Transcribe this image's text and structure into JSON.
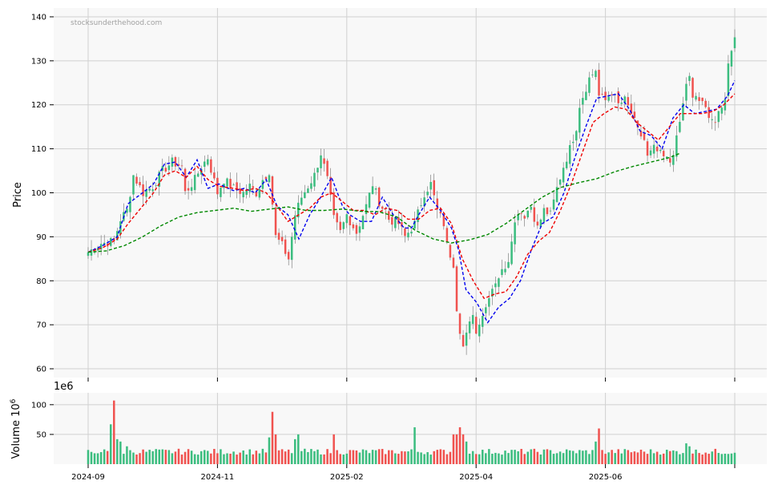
{
  "watermark": "stocksunderthehood.com",
  "colors": {
    "up": "#3bbd7f",
    "down": "#f0524f",
    "ma_fast": "#0000ee",
    "ma_mid": "#ee0000",
    "ma_slow": "#008800",
    "panel_bg": "#f8f8f8",
    "grid": "#d0d0d0"
  },
  "chart_data": [
    {
      "type": "candlestick",
      "ylabel": "Price",
      "ylim": [
        58,
        142
      ],
      "yticks": [
        60,
        70,
        80,
        90,
        100,
        110,
        120,
        130,
        140
      ],
      "grid": true,
      "x_date_labels": [
        "2024-09",
        "2024-11",
        "2025-02",
        "2025-04",
        "2025-06"
      ],
      "x_date_positions": [
        0,
        40,
        80,
        120,
        160
      ],
      "n_bars": 201,
      "close_anchors": [
        [
          0,
          86.5
        ],
        [
          4,
          88.5
        ],
        [
          8,
          89
        ],
        [
          10,
          94
        ],
        [
          12,
          96
        ],
        [
          14,
          104
        ],
        [
          17,
          100
        ],
        [
          20,
          101.5
        ],
        [
          23,
          105
        ],
        [
          26,
          107
        ],
        [
          29,
          106
        ],
        [
          30,
          100
        ],
        [
          33,
          103
        ],
        [
          35,
          106
        ],
        [
          37,
          108
        ],
        [
          40,
          100
        ],
        [
          42,
          103
        ],
        [
          45,
          101
        ],
        [
          48,
          100
        ],
        [
          50,
          101.5
        ],
        [
          52,
          100
        ],
        [
          54,
          103
        ],
        [
          56,
          105
        ],
        [
          58,
          90
        ],
        [
          60,
          88
        ],
        [
          62,
          85
        ],
        [
          64,
          95
        ],
        [
          66,
          99
        ],
        [
          68,
          101.5
        ],
        [
          70,
          104
        ],
        [
          72,
          109
        ],
        [
          74,
          103
        ],
        [
          76,
          94
        ],
        [
          78,
          91
        ],
        [
          80,
          95
        ],
        [
          83,
          91
        ],
        [
          86,
          97
        ],
        [
          88,
          102
        ],
        [
          90,
          98
        ],
        [
          93,
          94
        ],
        [
          96,
          93
        ],
        [
          98,
          90
        ],
        [
          101,
          93
        ],
        [
          104,
          100
        ],
        [
          106,
          102
        ],
        [
          108,
          96
        ],
        [
          110,
          93
        ],
        [
          111,
          88
        ],
        [
          113,
          84
        ],
        [
          114,
          74
        ],
        [
          115,
          69
        ],
        [
          116,
          65
        ],
        [
          118,
          70
        ],
        [
          119,
          73
        ],
        [
          120,
          68
        ],
        [
          121,
          71
        ],
        [
          123,
          74
        ],
        [
          124,
          77
        ],
        [
          126,
          80
        ],
        [
          128,
          82
        ],
        [
          130,
          85
        ],
        [
          131,
          90
        ],
        [
          133,
          96
        ],
        [
          135,
          95
        ],
        [
          137,
          97
        ],
        [
          139,
          92
        ],
        [
          141,
          96
        ],
        [
          143,
          95
        ],
        [
          145,
          101
        ],
        [
          147,
          106
        ],
        [
          149,
          110
        ],
        [
          151,
          115
        ],
        [
          152,
          120
        ],
        [
          155,
          126
        ],
        [
          157,
          128
        ],
        [
          158,
          122
        ],
        [
          160,
          121
        ],
        [
          162,
          123
        ],
        [
          164,
          120
        ],
        [
          166,
          121
        ],
        [
          168,
          118
        ],
        [
          170,
          114
        ],
        [
          172,
          112
        ],
        [
          173,
          108
        ],
        [
          175,
          110
        ],
        [
          178,
          108
        ],
        [
          180,
          107
        ],
        [
          182,
          112
        ],
        [
          184,
          120
        ],
        [
          185,
          125
        ],
        [
          186,
          126
        ],
        [
          187,
          121
        ],
        [
          188,
          122
        ],
        [
          190,
          120
        ],
        [
          192,
          118
        ],
        [
          194,
          116
        ],
        [
          196,
          119
        ],
        [
          197,
          122
        ],
        [
          198,
          129
        ],
        [
          199,
          133
        ],
        [
          200,
          136
        ]
      ],
      "series": [
        {
          "name": "",
          "color_key": "ma_fast",
          "values": [
            [
              0,
              86.5
            ],
            [
              4,
              88
            ],
            [
              8,
              90
            ],
            [
              11,
              97.5
            ],
            [
              15,
              100
            ],
            [
              18,
              102
            ],
            [
              21,
              106.5
            ],
            [
              24,
              107
            ],
            [
              27,
              103.5
            ],
            [
              30,
              107.5
            ],
            [
              33,
              101
            ],
            [
              36,
              102
            ],
            [
              40,
              100.5
            ],
            [
              43,
              101
            ],
            [
              46,
              100
            ],
            [
              49,
              103
            ],
            [
              52,
              97
            ],
            [
              55,
              95
            ],
            [
              58,
              89.5
            ],
            [
              61,
              95
            ],
            [
              64,
              99
            ],
            [
              67,
              103.5
            ],
            [
              70,
              97
            ],
            [
              72,
              95
            ],
            [
              75,
              93.5
            ],
            [
              78,
              93.5
            ],
            [
              81,
              99
            ],
            [
              84,
              95
            ],
            [
              87,
              92
            ],
            [
              89,
              92
            ],
            [
              91,
              95
            ],
            [
              94,
              99
            ],
            [
              97,
              96
            ],
            [
              100,
              92
            ],
            [
              102,
              87
            ],
            [
              104,
              78
            ],
            [
              107,
              75
            ],
            [
              110,
              70.5
            ],
            [
              113,
              74
            ],
            [
              116,
              76
            ],
            [
              119,
              80
            ],
            [
              122,
              87
            ],
            [
              125,
              93
            ],
            [
              128,
              94.5
            ],
            [
              131,
              100
            ],
            [
              134,
              108
            ],
            [
              137,
              115
            ],
            [
              140,
              121.5
            ],
            [
              143,
              122
            ],
            [
              146,
              122.5
            ],
            [
              149,
              119
            ],
            [
              152,
              114
            ],
            [
              155,
              113
            ],
            [
              158,
              110
            ],
            [
              161,
              117
            ],
            [
              164,
              120
            ],
            [
              167,
              118
            ],
            [
              170,
              118.5
            ],
            [
              173,
              119
            ],
            [
              176,
              122
            ],
            [
              178,
              125.5
            ]
          ]
        },
        {
          "name": "",
          "color_key": "ma_mid",
          "values": [
            [
              0,
              86.5
            ],
            [
              4,
              87.5
            ],
            [
              8,
              89.5
            ],
            [
              11,
              93
            ],
            [
              15,
              97
            ],
            [
              18,
              100
            ],
            [
              21,
              104
            ],
            [
              24,
              105
            ],
            [
              27,
              103.5
            ],
            [
              30,
              106
            ],
            [
              33,
              103
            ],
            [
              36,
              101.5
            ],
            [
              40,
              101
            ],
            [
              43,
              100.5
            ],
            [
              46,
              101
            ],
            [
              49,
              100
            ],
            [
              52,
              97
            ],
            [
              55,
              93.5
            ],
            [
              58,
              95
            ],
            [
              61,
              96.5
            ],
            [
              64,
              99
            ],
            [
              67,
              100
            ],
            [
              70,
              98
            ],
            [
              73,
              96
            ],
            [
              76,
              96
            ],
            [
              79,
              95
            ],
            [
              82,
              96.5
            ],
            [
              85,
              96
            ],
            [
              88,
              94
            ],
            [
              91,
              94
            ],
            [
              94,
              96
            ],
            [
              97,
              96.5
            ],
            [
              100,
              93
            ],
            [
              103,
              85
            ],
            [
              106,
              80
            ],
            [
              109,
              76
            ],
            [
              112,
              77
            ],
            [
              115,
              77.5
            ],
            [
              118,
              81
            ],
            [
              121,
              86
            ],
            [
              124,
              89
            ],
            [
              127,
              91
            ],
            [
              130,
              96
            ],
            [
              133,
              102
            ],
            [
              136,
              109
            ],
            [
              139,
              116
            ],
            [
              142,
              118
            ],
            [
              145,
              119.5
            ],
            [
              148,
              119
            ],
            [
              151,
              116
            ],
            [
              154,
              114
            ],
            [
              157,
              112
            ],
            [
              160,
              115
            ],
            [
              163,
              118
            ],
            [
              166,
              118
            ],
            [
              169,
              118
            ],
            [
              172,
              118.5
            ],
            [
              175,
              120
            ],
            [
              178,
              122.5
            ]
          ]
        },
        {
          "name": "",
          "color_key": "ma_slow",
          "values": [
            [
              0,
              86.5
            ],
            [
              5,
              86.8
            ],
            [
              10,
              88
            ],
            [
              15,
              90
            ],
            [
              20,
              92.5
            ],
            [
              25,
              94.5
            ],
            [
              30,
              95.5
            ],
            [
              35,
              96
            ],
            [
              40,
              96.5
            ],
            [
              45,
              95.8
            ],
            [
              50,
              96.3
            ],
            [
              55,
              96.8
            ],
            [
              60,
              96
            ],
            [
              65,
              96
            ],
            [
              70,
              96.3
            ],
            [
              75,
              95.8
            ],
            [
              80,
              95.7
            ],
            [
              85,
              94.5
            ],
            [
              90,
              91.5
            ],
            [
              95,
              89.5
            ],
            [
              100,
              88.6
            ],
            [
              105,
              89.3
            ],
            [
              110,
              90.5
            ],
            [
              115,
              93
            ],
            [
              120,
              96
            ],
            [
              125,
              99
            ],
            [
              130,
              101.2
            ],
            [
              135,
              102.3
            ],
            [
              140,
              103.2
            ],
            [
              145,
              104.8
            ],
            [
              150,
              106
            ],
            [
              155,
              107
            ],
            [
              160,
              108
            ],
            [
              163,
              109
            ]
          ]
        }
      ]
    },
    {
      "type": "bar",
      "ylabel": "Volume",
      "ylabel_unit": "10",
      "ylabel_unit_exp": "6",
      "offset_label": "1e6",
      "ylim": [
        0,
        120
      ],
      "yticks": [
        50,
        100
      ],
      "grid": true,
      "volume_spikes": [
        [
          7,
          67
        ],
        [
          8,
          107
        ],
        [
          9,
          42
        ],
        [
          10,
          38
        ],
        [
          12,
          30
        ],
        [
          56,
          45
        ],
        [
          57,
          88
        ],
        [
          58,
          50
        ],
        [
          64,
          42
        ],
        [
          65,
          50
        ],
        [
          76,
          50
        ],
        [
          101,
          62
        ],
        [
          113,
          50
        ],
        [
          114,
          50
        ],
        [
          115,
          62
        ],
        [
          116,
          50
        ],
        [
          117,
          38
        ],
        [
          157,
          38
        ],
        [
          158,
          60
        ],
        [
          185,
          35
        ],
        [
          186,
          30
        ]
      ],
      "volume_base": 20
    }
  ]
}
